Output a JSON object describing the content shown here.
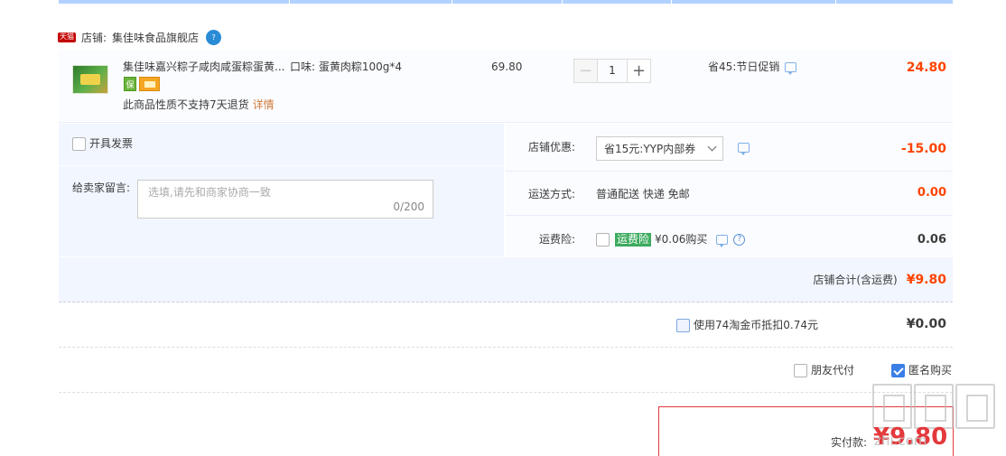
{
  "shop": {
    "badge": "天猫",
    "label": "店铺:",
    "name": "集佳味食品旗舰店",
    "chat_icon_text": "?"
  },
  "item": {
    "title": "集佳味嘉兴粽子咸肉咸蛋粽蛋黄...",
    "sku": "口味: 蛋黄肉粽100g*4",
    "service_icon_text": "保",
    "no_return": "此商品性质不支持7天退货",
    "details_link": "详情",
    "unit_price": "69.80",
    "quantity": "1",
    "qty_minus": "−",
    "qty_plus": "+",
    "promo": "省45:节日促销",
    "subtotal": "24.80"
  },
  "invoice": {
    "label": "开具发票"
  },
  "memo": {
    "label": "给卖家留言:",
    "placeholder": "选填,请先和商家协商一致",
    "count": "0/200"
  },
  "coupon": {
    "label": "店铺优惠:",
    "selected": "省15元:YYP内部券",
    "amount": "-15.00"
  },
  "shipping": {
    "label": "运送方式:",
    "value": "普通配送 快递 免邮",
    "amount": "0.00"
  },
  "insurance": {
    "label": "运费险:",
    "badge": "运费险",
    "text": "¥0.06购买",
    "help": "?",
    "amount": "0.06"
  },
  "shop_total": {
    "label": "店铺合计(含运费)",
    "amount": "¥9.80"
  },
  "coins": {
    "label": "使用74淘金币抵扣0.74元",
    "amount": "¥0.00"
  },
  "friend_pay": {
    "label": "朋友代付"
  },
  "anonymous": {
    "label": "匿名购买"
  },
  "payment": {
    "label": "实付款:",
    "amount": "¥9.80"
  },
  "watermark": {
    "text": "zhi.com"
  },
  "colors": {
    "price_red": "#ff4400",
    "header_blue": "#b2d1ff",
    "row_bg": "#f1f6ff",
    "insurance_green": "#3cab5e",
    "checkbox_blue": "#3a7ee6"
  }
}
